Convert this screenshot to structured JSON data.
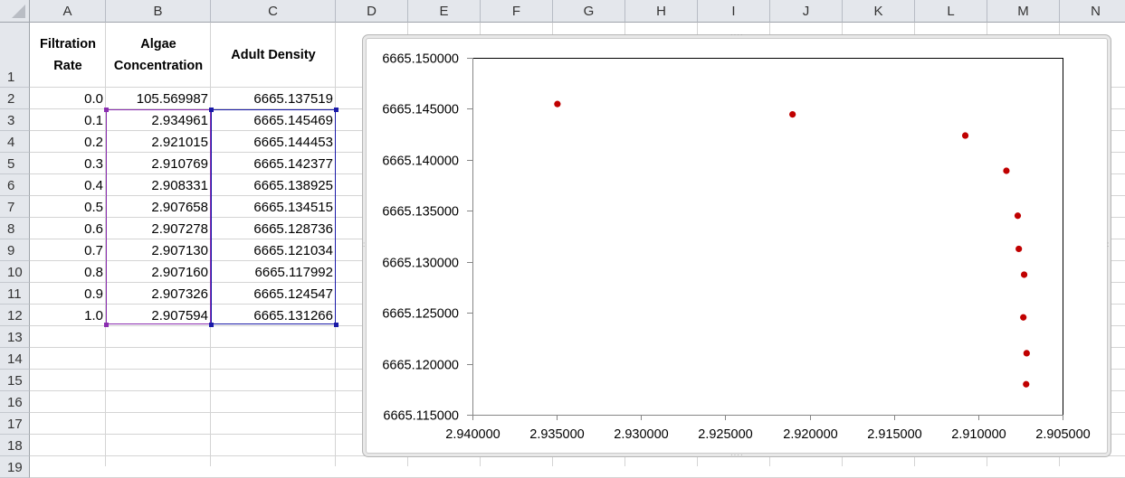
{
  "spreadsheet": {
    "column_headers": [
      "A",
      "B",
      "C",
      "D",
      "E",
      "F",
      "G",
      "H",
      "I",
      "J",
      "K",
      "L",
      "M",
      "N"
    ],
    "row_headers": [
      "1",
      "2",
      "3",
      "4",
      "5",
      "6",
      "7",
      "8",
      "9",
      "10",
      "11",
      "12",
      "13",
      "14",
      "15",
      "16",
      "17",
      "18",
      "19"
    ],
    "header_row": {
      "A": [
        "Filtration",
        "Rate"
      ],
      "B": [
        "Algae",
        "Concentration"
      ],
      "C": [
        "Adult Density"
      ]
    },
    "rows": [
      {
        "A": "0.0",
        "B": "105.569987",
        "C": "6665.137519"
      },
      {
        "A": "0.1",
        "B": "2.934961",
        "C": "6665.145469"
      },
      {
        "A": "0.2",
        "B": "2.921015",
        "C": "6665.144453"
      },
      {
        "A": "0.3",
        "B": "2.910769",
        "C": "6665.142377"
      },
      {
        "A": "0.4",
        "B": "2.908331",
        "C": "6665.138925"
      },
      {
        "A": "0.5",
        "B": "2.907658",
        "C": "6665.134515"
      },
      {
        "A": "0.6",
        "B": "2.907278",
        "C": "6665.128736"
      },
      {
        "A": "0.7",
        "B": "2.907130",
        "C": "6665.121034"
      },
      {
        "A": "0.8",
        "B": "2.907160",
        "C": "6665.117992"
      },
      {
        "A": "0.9",
        "B": "2.907326",
        "C": "6665.124547"
      },
      {
        "A": "1.0",
        "B": "2.907594",
        "C": "6665.131266"
      }
    ],
    "selection_colors": {
      "x_range": "#8a2db0",
      "y_range": "#1a1aa8"
    }
  },
  "chart_data": {
    "type": "scatter",
    "title": "",
    "xlabel": "",
    "ylabel": "",
    "legend": "none",
    "grid": false,
    "x_reversed": true,
    "xlim": [
      2.905,
      2.94
    ],
    "ylim": [
      6665.115,
      6665.15
    ],
    "x_ticks": [
      2.94,
      2.935,
      2.93,
      2.925,
      2.92,
      2.915,
      2.91,
      2.905
    ],
    "x_tick_labels": [
      "2.940000",
      "2.935000",
      "2.930000",
      "2.925000",
      "2.920000",
      "2.915000",
      "2.910000",
      "2.905000"
    ],
    "y_ticks": [
      6665.15,
      6665.145,
      6665.14,
      6665.135,
      6665.13,
      6665.125,
      6665.12,
      6665.115
    ],
    "y_tick_labels": [
      "6665.150000",
      "6665.145000",
      "6665.140000",
      "6665.135000",
      "6665.130000",
      "6665.125000",
      "6665.120000",
      "6665.115000"
    ],
    "series": [
      {
        "name": "Adult Density",
        "color": "#c00000",
        "x": [
          2.934961,
          2.921015,
          2.910769,
          2.908331,
          2.907658,
          2.907278,
          2.90713,
          2.90716,
          2.907326,
          2.907594
        ],
        "y": [
          6665.145469,
          6665.144453,
          6665.142377,
          6665.138925,
          6665.134515,
          6665.128736,
          6665.121034,
          6665.117992,
          6665.124547,
          6665.131266
        ]
      }
    ]
  }
}
